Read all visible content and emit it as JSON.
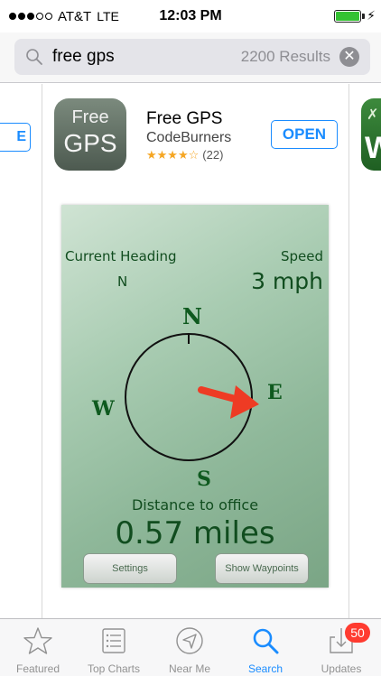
{
  "status_bar": {
    "signal_filled": 3,
    "signal_total": 5,
    "carrier": "AT&T",
    "network": "LTE",
    "time": "12:03 PM",
    "battery_level": 1.0,
    "battery_color": "#34c232"
  },
  "search": {
    "query": "free gps",
    "results": "2200 Results",
    "clear_icon": "clear-icon"
  },
  "results": {
    "previous_action_label": "E",
    "app": {
      "icon_text_top": "Free",
      "icon_text_bottom": "GPS",
      "name": "Free GPS",
      "developer": "CodeBurners",
      "stars": "★★★★☆",
      "rating_value": 4,
      "rating_count": "(22)",
      "action_label": "OPEN"
    },
    "next_app_icon_letter": "W",
    "screenshot": {
      "heading_label": "Current Heading",
      "heading_value": "N",
      "speed_label": "Speed",
      "speed_value": "3 mph",
      "compass_n": "N",
      "compass_e": "E",
      "compass_s": "S",
      "compass_w": "W",
      "distance_label": "Distance to office",
      "distance_value": "0.57 miles",
      "settings_button": "Settings",
      "waypoints_button": "Show Waypoints"
    }
  },
  "tab_bar": {
    "tabs": [
      {
        "label": "Featured",
        "icon": "star-icon"
      },
      {
        "label": "Top Charts",
        "icon": "list-icon"
      },
      {
        "label": "Near Me",
        "icon": "location-arrow-icon"
      },
      {
        "label": "Search",
        "icon": "search-icon",
        "active": true
      },
      {
        "label": "Updates",
        "icon": "download-icon"
      }
    ],
    "updates_badge": "50",
    "active_color": "#1a8cff",
    "inactive_color": "#929292"
  }
}
